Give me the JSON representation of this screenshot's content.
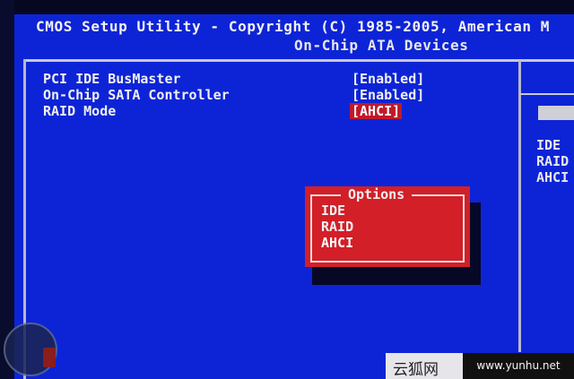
{
  "header": {
    "title": "CMOS Setup Utility - Copyright (C) 1985-2005, American M",
    "subtitle": "On-Chip ATA Devices"
  },
  "settings": [
    {
      "label": "PCI IDE BusMaster",
      "value": "[Enabled]"
    },
    {
      "label": "On-Chip SATA Controller",
      "value": "[Enabled]"
    },
    {
      "label": "RAID Mode",
      "value": "[AHCI]"
    }
  ],
  "help": {
    "options": [
      "IDE",
      "RAID",
      "AHCI"
    ]
  },
  "popup": {
    "title": "Options",
    "options": [
      "IDE",
      "RAID",
      "AHCI"
    ],
    "selected": "AHCI"
  },
  "watermark": {
    "site_name_cn": "云狐网",
    "site_url": "www.yunhu.net"
  },
  "colors": {
    "background": "#0d24d6",
    "highlight": "#c0192a",
    "popup": "#d21f28",
    "text": "#f0f0f0"
  }
}
